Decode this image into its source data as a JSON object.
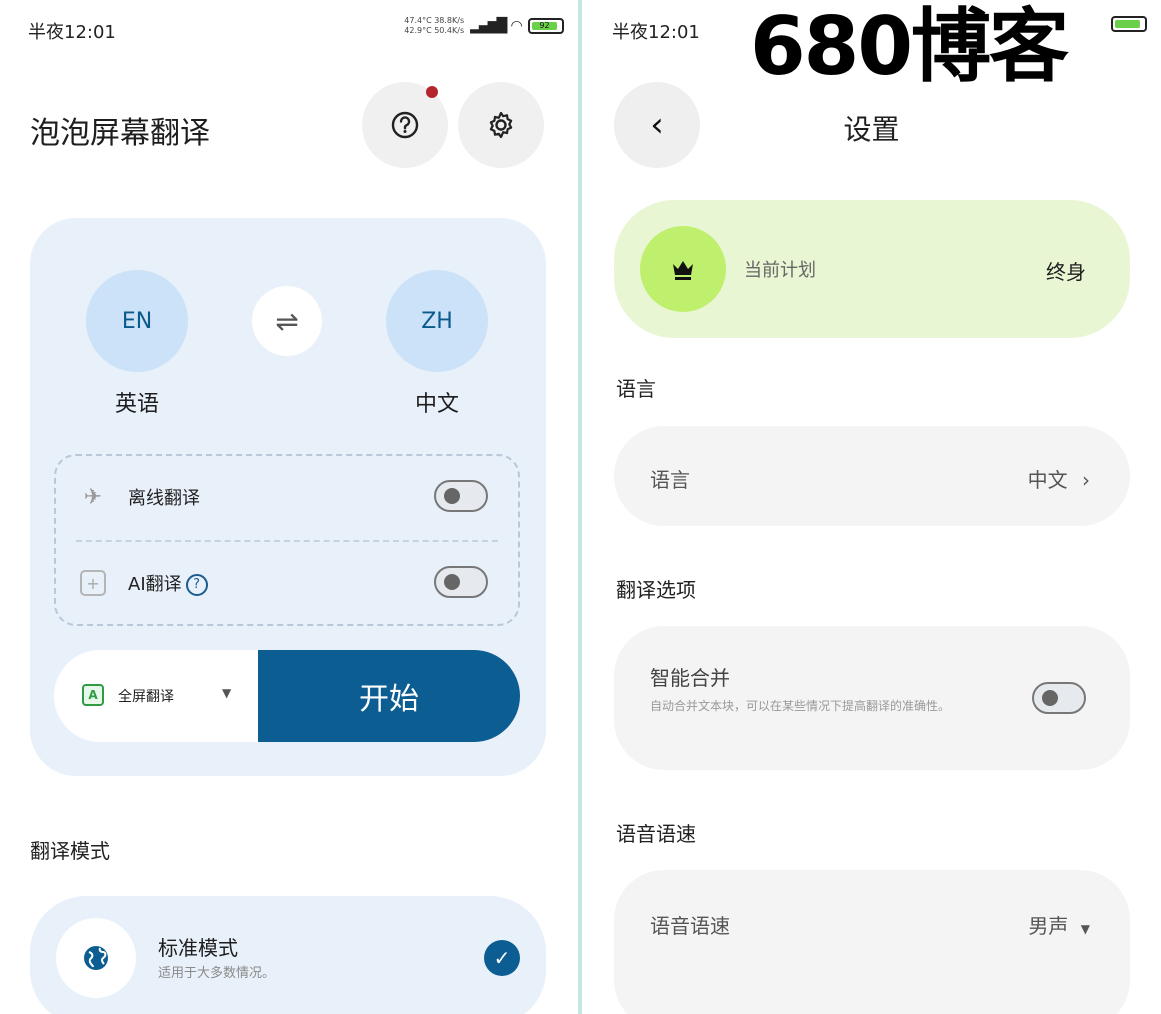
{
  "status_bar": {
    "time": "半夜12:01",
    "net_line1": "47.4°C 38.8K/s",
    "net_line2": "42.9°C 50.4K/s",
    "battery": "92"
  },
  "left_screen": {
    "app_title": "泡泡屏幕翻译",
    "source_lang_code": "EN",
    "source_lang_name": "英语",
    "target_lang_code": "ZH",
    "target_lang_name": "中文",
    "offline_label": "离线翻译",
    "ai_label": "AI翻译",
    "mode_select_label": "全屏翻译",
    "start_label": "开始",
    "mode_section_title": "翻译模式",
    "standard_mode_name": "标准模式",
    "standard_mode_desc": "适用于大多数情况。"
  },
  "right_screen": {
    "watermark": "680博客",
    "title": "设置",
    "plan_label": "当前计划",
    "plan_value": "终身",
    "lang_section": "语言",
    "lang_label": "语言",
    "lang_value": "中文",
    "translate_section": "翻译选项",
    "smart_merge_label": "智能合并",
    "smart_merge_desc": "自动合并文本块，可以在某些情况下提高翻译的准确性。",
    "voice_section": "语音语速",
    "voice_label": "语音语速",
    "voice_value": "男声"
  },
  "icons": {
    "help": "question-icon",
    "settings": "gear-icon",
    "swap": "swap-icon",
    "airplane": "airplane-icon",
    "ai": "plus-box-icon",
    "globe": "globe-icon",
    "check": "check-icon",
    "back": "chevron-left-icon",
    "crown": "crown-icon",
    "chevron_right": "chevron-right-icon",
    "caret_down": "caret-down-icon"
  },
  "colors": {
    "primary": "#0b5d92",
    "card_bg": "#e8f0fa",
    "plan_bg": "#e9f6d4",
    "crown_bg": "#bff06d",
    "notification": "#b3262b"
  }
}
